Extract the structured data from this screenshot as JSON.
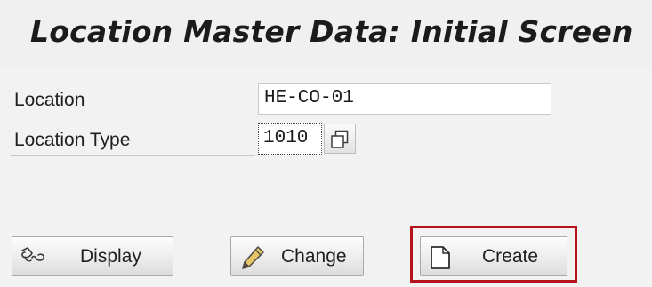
{
  "header": {
    "title": "Location Master Data: Initial Screen"
  },
  "form": {
    "location": {
      "label": "Location",
      "value": "HE-CO-01"
    },
    "location_type": {
      "label": "Location Type",
      "value": "1010"
    }
  },
  "actions": {
    "display_label": "Display",
    "change_label": "Change",
    "create_label": "Create"
  },
  "icons": {
    "display": "glasses-icon",
    "change": "pencil-icon",
    "create": "blank-document-icon",
    "value_help": "value-help-icon"
  },
  "colors": {
    "highlight": "#b5121b",
    "background": "#f2f2f2"
  }
}
